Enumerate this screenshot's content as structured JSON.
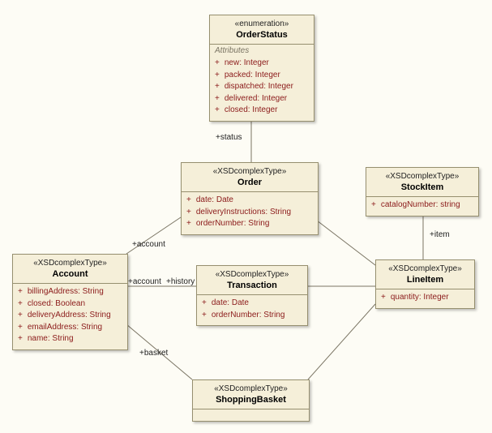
{
  "diagram": {
    "classes": {
      "OrderStatus": {
        "stereotype": "«enumeration»",
        "name": "OrderStatus",
        "sectionLabel": "Attributes",
        "attrs": [
          "new: Integer",
          "packed: Integer",
          "dispatched: Integer",
          "delivered: Integer",
          "closed: Integer"
        ]
      },
      "Order": {
        "stereotype": "«XSDcomplexType»",
        "name": "Order",
        "attrs": [
          "date: Date",
          "deliveryInstructions: String",
          "orderNumber: String"
        ]
      },
      "StockItem": {
        "stereotype": "«XSDcomplexType»",
        "name": "StockItem",
        "attrs": [
          "catalogNumber: string"
        ]
      },
      "Account": {
        "stereotype": "«XSDcomplexType»",
        "name": "Account",
        "attrs": [
          "billingAddress: String",
          "closed: Boolean",
          "deliveryAddress: String",
          "emailAddress: String",
          "name: String"
        ]
      },
      "Transaction": {
        "stereotype": "«XSDcomplexType»",
        "name": "Transaction",
        "attrs": [
          "date: Date",
          "orderNumber: String"
        ]
      },
      "LineItem": {
        "stereotype": "«XSDcomplexType»",
        "name": "LineItem",
        "attrs": [
          "quantity: Integer"
        ]
      },
      "ShoppingBasket": {
        "stereotype": "«XSDcomplexType»",
        "name": "ShoppingBasket"
      }
    },
    "labels": {
      "status": "+status",
      "account1": "+account",
      "account2": "+account",
      "history": "+history",
      "basket": "+basket",
      "item": "+item"
    }
  }
}
